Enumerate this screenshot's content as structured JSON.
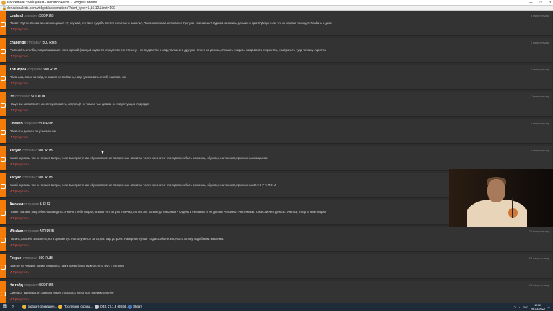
{
  "window": {
    "title": "Последние сообщения - DonationAlerts - Google Chrome",
    "url": "donationalerts.com/widget/lastdonations?alert_type=1,16,12&limit=100",
    "controls": [
      "—",
      "□",
      "✕"
    ]
  },
  "colors": {
    "accent": "#f57d07",
    "skip_link": "#e05454",
    "row_bg": "#333333",
    "page_bg": "#2e2e2e"
  },
  "messages": [
    {
      "user": "Lealand",
      "sent": "отправил",
      "amount": "500 RUB",
      "time": "6 минут назад",
      "text": "Привет Путин. Снова писная концовка? Ну слушай, это твоя судьба. Кстати если ты не заметил, Папочка пропал и появился Гунчука - смекаешь? Лурком на казика деньги не дают? Деды если что по картом проходят. Разбань в диск",
      "skip": "Пропустить"
    },
    {
      "user": "challenge",
      "sent": "отправил",
      "amount": "500 RUB",
      "time": "3 минут назад",
      "text": "Растокайть столбы, подкопывающие его энергией (каждый падает в определённую сторону – не поддаётся в ходу, толкаем в другую) Ничего не делать, слушать и ждать, когда врата откроются, и забросить туда головку Агрипты",
      "skip": "Пропустить"
    },
    {
      "user": "Топ игрок",
      "sent": "отправил",
      "amount": "500 RUB",
      "time": "3 минут назад",
      "text": "Папанька, сорок за гайд не значит не пойминь, надо удерживать стопб и шагать его",
      "skip": "Пропустить"
    },
    {
      "user": "!!!!",
      "sent": "отправил",
      "amount": "500 RUB",
      "time": "3 минут назад",
      "text": "Накуя вы заставляете меня перепираеть, казуалы)! не помню чья цитата, но под ситуацию подходит.",
      "skip": "Пропустить"
    },
    {
      "user": "Сокмер",
      "sent": "отправил",
      "amount": "500 RUB",
      "time": "4 минут назад",
      "text": "Папич ты должен тянуть колонны",
      "skip": "Пропустить"
    },
    {
      "user": "Казуал",
      "sent": "отправил",
      "amount": "500 RUB",
      "time": "4 минут назад",
      "text": "Какой верпись, так не играют в игры, если вы играете как обучно вонючие прекрэнные казуалы, то это не значит что я должен быть вонючим, ибучим, нештожным, прекрэнным казуалом",
      "skip": "Пропустить"
    },
    {
      "user": "Казуал",
      "sent": "отправил",
      "amount": "500 RUB",
      "time": "4 минут назад",
      "text": "Какой верпись, так не играют в игры, если вы играете как обучно вонючие прекрэнные казуалы, то это не значит что я должен быть вонючим, ибучим, нештожным, прекрэнным К А З У А Л О М",
      "skip": "Пропустить"
    },
    {
      "user": "Аноним",
      "sent": "отправил",
      "amount": "6 EUR",
      "time": "5 минут назад",
      "text": "Привет папанк, рад тебя снова видеть. У меня к тебе вопрос, я знаю что ты уже отвечал, но всё же. Ты всегда говоришь что деньги не важны и не делают человека счастливым. Так если не в деньгах счастье, тогда в чём? Мерси",
      "skip": "Пропустить"
    },
    {
      "user": "Wisdom",
      "sent": "отправил",
      "amount": "500 RUB",
      "time": "25 минут назад",
      "text": "Папанк, спасибо за ответы, но в целом грустно получается за то, как мир устроен. Наверное лучше тогда особо не загружать голову подобными мыслями.",
      "skip": "Пропустить"
    },
    {
      "user": "Генрих",
      "sent": "отправил",
      "amount": "500 RUB",
      "time": "25 минут назад",
      "text": "там где на чекпике линии появились там и кровь будет нужно снять груз с потолка",
      "skip": "Пропустить"
    },
    {
      "user": "Не гайд",
      "sent": "отправил",
      "amount": "500 RUB",
      "time": "40 минут назад",
      "text": "Смена от агрипты где комната новая открылась чкеки пол повнимательнее",
      "skip": "Пропустить"
    }
  ],
  "taskbar": {
    "start_icon": "windows-icon",
    "search_icon": "search-icon",
    "tasks": [
      {
        "label": "Бюджет оповещен...",
        "icon": "chrome-icon",
        "color": "#e8b83c"
      },
      {
        "label": "Последние сообщ...",
        "icon": "chrome-icon",
        "color": "#e8b83c"
      },
      {
        "label": "OBS 27.1.3 (64-bit,...",
        "icon": "obs-icon",
        "color": "#cccccc"
      },
      {
        "label": "Steam",
        "icon": "steam-icon",
        "color": "#4a7ab8"
      }
    ],
    "tray": {
      "lang": "РУС",
      "time": "19:30",
      "date": "04.03.2022"
    }
  }
}
